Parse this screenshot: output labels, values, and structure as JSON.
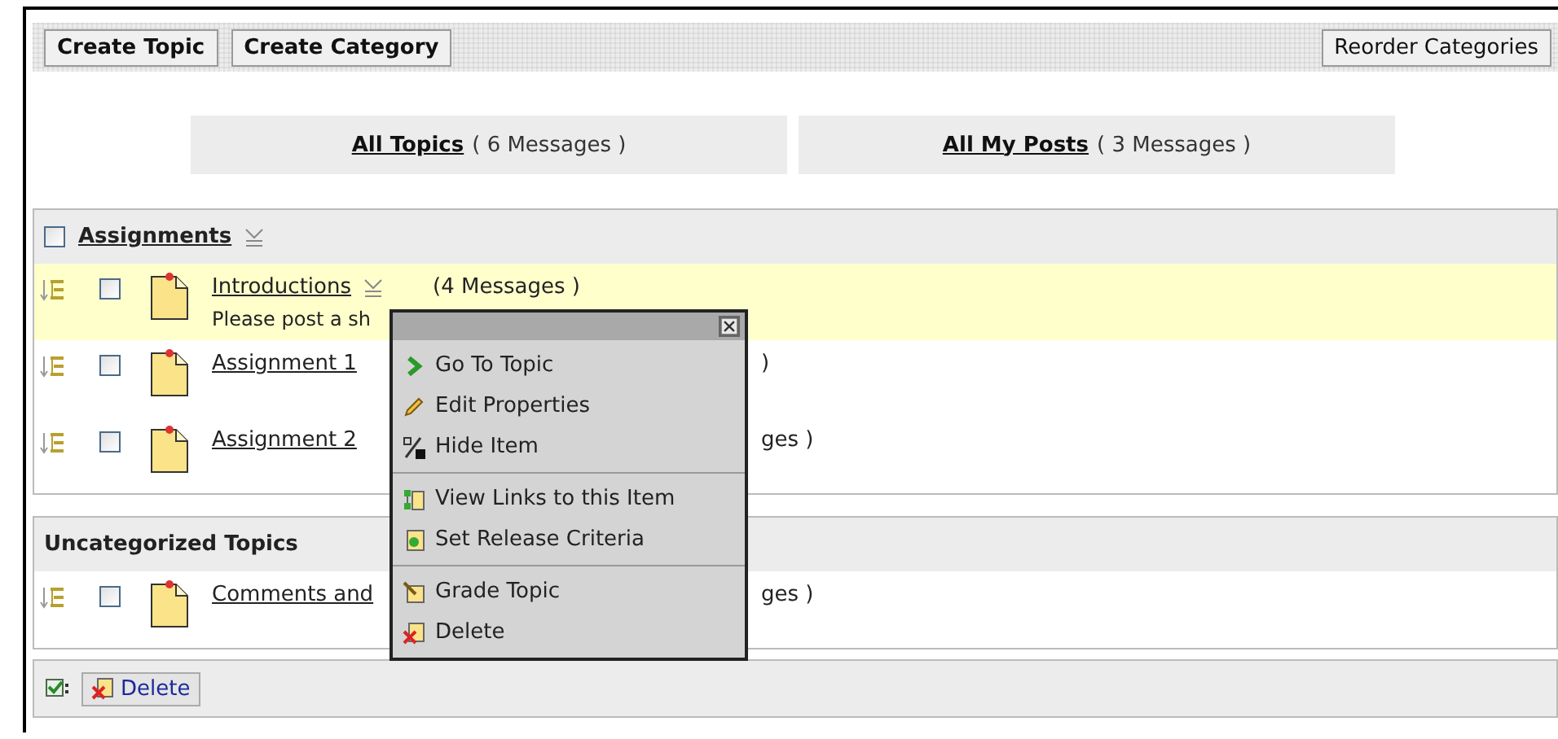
{
  "toolbar": {
    "left_buttons": [
      "Create Topic",
      "Create Category"
    ],
    "right_buttons": [
      "Reorder Categories"
    ]
  },
  "views": [
    {
      "label": "All Topics",
      "count": "( 6 Messages )"
    },
    {
      "label": "All My Posts",
      "count": "( 3 Messages )"
    }
  ],
  "categories": [
    {
      "title": "Assignments",
      "kind": "category",
      "checked": false,
      "topics": [
        {
          "title": "Introductions",
          "kind": "full",
          "count": "(4 Messages )",
          "description": "Please post a sh",
          "selected": true,
          "checked": false
        },
        {
          "title": "Assignment 1",
          "kind": "covered",
          "count": ")",
          "selected": false,
          "checked": false
        },
        {
          "title": "Assignment 2",
          "kind": "covered",
          "count": "ges )",
          "selected": false,
          "checked": false
        }
      ]
    },
    {
      "title": "Uncategorized Topics",
      "kind": "uncategorized",
      "topics": [
        {
          "title": "Comments and",
          "kind": "covered",
          "count": "ges )",
          "selected": false,
          "checked": false
        }
      ]
    }
  ],
  "context_menu": {
    "groups": [
      {
        "items": [
          {
            "label": "Go To Topic",
            "kind": "go"
          },
          {
            "label": "Edit Properties",
            "kind": "edit"
          },
          {
            "label": "Hide Item",
            "kind": "hide"
          }
        ]
      },
      {
        "items": [
          {
            "label": "View Links to this Item",
            "kind": "links"
          },
          {
            "label": "Set Release Criteria",
            "kind": "release"
          }
        ]
      },
      {
        "items": [
          {
            "label": "Grade Topic",
            "kind": "grade"
          },
          {
            "label": "Delete",
            "kind": "delete"
          }
        ]
      }
    ]
  },
  "footer": {
    "delete_label": "Delete"
  }
}
